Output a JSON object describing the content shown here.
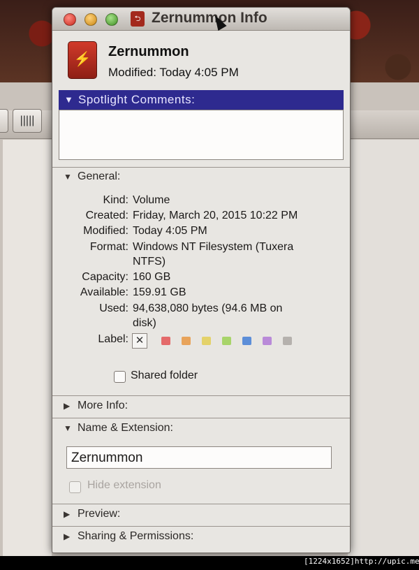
{
  "window": {
    "title": "Zernummon Info"
  },
  "header": {
    "volume_name": "Zernummon",
    "modified": "Modified: Today 4:05 PM"
  },
  "spotlight": {
    "label": "Spotlight Comments:",
    "value": ""
  },
  "general": {
    "label": "General:",
    "fields": [
      {
        "key": "Kind:",
        "value": "Volume"
      },
      {
        "key": "Created:",
        "value": "Friday, March 20, 2015 10:22 PM"
      },
      {
        "key": "Modified:",
        "value": "Today 4:05 PM"
      },
      {
        "key": "Format:",
        "value": "Windows NT Filesystem (Tuxera",
        "value2": "NTFS)"
      },
      {
        "key": "Capacity:",
        "value": "160 GB"
      },
      {
        "key": "Available:",
        "value": "159.91 GB"
      },
      {
        "key": "Used:",
        "value": "94,638,080 bytes (94.6 MB on",
        "value2": "disk)"
      }
    ],
    "label_key": "Label:",
    "label_colors": [
      "#e46a6a",
      "#e8a35a",
      "#e4d26a",
      "#a8d46a",
      "#5c8ed8",
      "#b98ad8",
      "#b5b1ad"
    ],
    "shared_folder": "Shared folder"
  },
  "more_info": {
    "label": "More Info:"
  },
  "name_extension": {
    "label": "Name & Extension:",
    "name_value": "Zernummon",
    "hide_extension": "Hide extension"
  },
  "preview": {
    "label": "Preview:"
  },
  "sharing": {
    "label": "Sharing & Permissions:"
  },
  "watermark": "[1224x1652]http://upic.me/",
  "colors": {
    "spotlight_header": "#2e2a8f",
    "window_bg": "#e8e6e2"
  }
}
